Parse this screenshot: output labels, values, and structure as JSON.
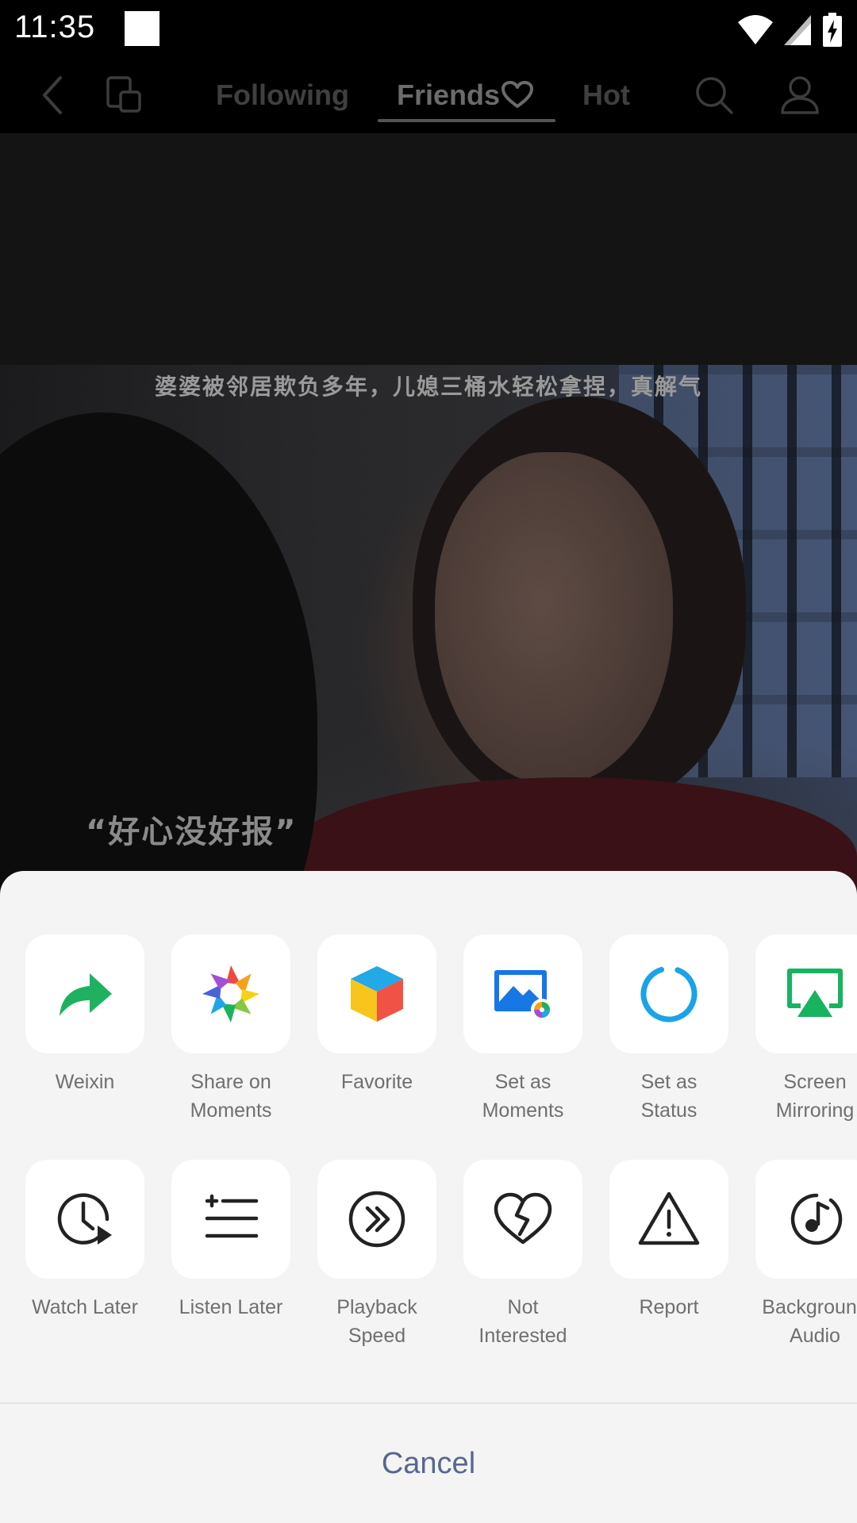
{
  "status_bar": {
    "time": "11:35",
    "icons": [
      "notification-square-icon",
      "wifi-icon",
      "cell-signal-icon",
      "battery-charging-icon"
    ]
  },
  "top_nav": {
    "back_icon": "chevron-left-icon",
    "cast_icon": "multi-screen-icon",
    "tabs": [
      {
        "label": "Following",
        "active": false
      },
      {
        "label": "Friends",
        "active": true,
        "icon": "heart-outline-icon"
      },
      {
        "label": "Hot",
        "active": false
      }
    ],
    "search_icon": "search-icon",
    "profile_icon": "person-icon"
  },
  "video": {
    "subtitle_top": "婆婆被邻居欺负多年，儿媳三桶水轻松拿捏，真解气",
    "subtitle_bottom": "“好心没好报”"
  },
  "share_sheet": {
    "row1": [
      {
        "label": "Weixin",
        "icon": "share-arrow-icon",
        "color": "#1fb160"
      },
      {
        "label": "Share on\nMoments",
        "icon": "moments-aperture-icon"
      },
      {
        "label": "Favorite",
        "icon": "favorite-cube-icon"
      },
      {
        "label": "Set as\nMoments",
        "icon": "image-moments-icon",
        "color": "#1677e5"
      },
      {
        "label": "Set as\nStatus",
        "icon": "status-ring-icon",
        "color": "#1aa3e8"
      },
      {
        "label": "Screen\nMirroring",
        "icon": "screen-mirroring-icon",
        "color": "#17b35f"
      }
    ],
    "row2": [
      {
        "label": "Watch Later",
        "icon": "watch-later-icon"
      },
      {
        "label": "Listen Later",
        "icon": "listen-later-icon"
      },
      {
        "label": "Playback\nSpeed",
        "icon": "playback-speed-icon"
      },
      {
        "label": "Not\nInterested",
        "icon": "broken-heart-icon"
      },
      {
        "label": "Report",
        "icon": "warning-triangle-icon"
      },
      {
        "label": "Background\nAudio",
        "icon": "background-audio-icon"
      }
    ],
    "cancel_label": "Cancel"
  }
}
